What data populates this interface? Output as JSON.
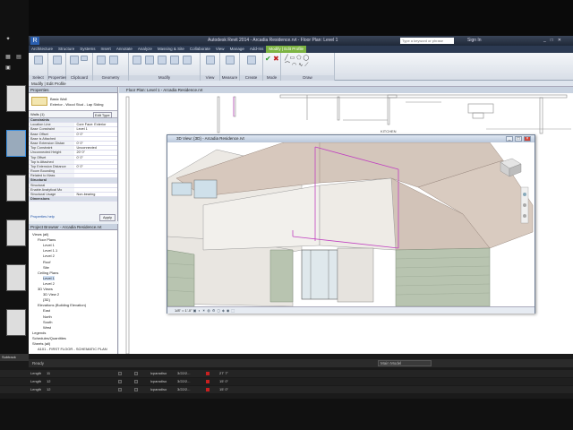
{
  "titlebar": {
    "title": "Autodesk Revit 2014 - Arcadia Residence.rvt - Floor Plan: Level 1",
    "search_placeholder": "Type a keyword or phrase",
    "sign_in": "Sign In"
  },
  "ribbon": {
    "tabs": [
      "Architecture",
      "Structure",
      "Systems",
      "Insert",
      "Annotate",
      "Analyze",
      "Massing & Site",
      "Collaborate",
      "View",
      "Manage",
      "Add-Ins",
      "Modify | Edit Profile"
    ],
    "active_tab": "Modify | Edit Profile",
    "groups": [
      "Select",
      "Properties",
      "Clipboard",
      "Geometry",
      "Modify",
      "View",
      "Measure",
      "Create",
      "Mode",
      "Draw"
    ]
  },
  "statusline": "Modify | Edit Profile",
  "properties": {
    "header": "Properties",
    "family": "Basic Wall",
    "type": "Exterior - Wood Stud - Lap Siding",
    "selector": "Walls (1)",
    "edit_type": "Edit Type",
    "rows": [
      {
        "k": "Constraints",
        "v": "",
        "sec": true
      },
      {
        "k": "Location Line",
        "v": "Core Face: Exterior"
      },
      {
        "k": "Base Constraint",
        "v": "Level 1"
      },
      {
        "k": "Base Offset",
        "v": "0' 0\""
      },
      {
        "k": "Base is Attached",
        "v": ""
      },
      {
        "k": "Base Extension Distan",
        "v": "0' 0\""
      },
      {
        "k": "Top Constraint",
        "v": "Unconnected"
      },
      {
        "k": "Unconnected Height",
        "v": "20' 0\""
      },
      {
        "k": "Top Offset",
        "v": "0' 0\""
      },
      {
        "k": "Top is Attached",
        "v": ""
      },
      {
        "k": "Top Extension Distance",
        "v": "0' 0\""
      },
      {
        "k": "Room Bounding",
        "v": ""
      },
      {
        "k": "Related to Mass",
        "v": ""
      },
      {
        "k": "Structural",
        "v": "",
        "sec": true
      },
      {
        "k": "Structural",
        "v": ""
      },
      {
        "k": "Enable Analytical Mo",
        "v": ""
      },
      {
        "k": "Structural Usage",
        "v": "Non-bearing"
      },
      {
        "k": "Dimensions",
        "v": "",
        "sec": true
      }
    ],
    "help_link": "Properties help",
    "apply": "Apply"
  },
  "browser": {
    "header": "Project Browser - Arcadia Residence.rvt",
    "items": [
      "Views (all)",
      "Floor Plans",
      "Level 1",
      "Level 1.1",
      "Level 2",
      "Roof",
      "Site",
      "Ceiling Plans",
      "Level 1",
      "Level 2",
      "3D Views",
      "3D View 2",
      "{3D}",
      "Elevations (Building Elevation)",
      "East",
      "North",
      "South",
      "West",
      "Legends",
      "Schedules/Quantities",
      "Sheets (all)",
      "A101 - FIRST FLOOR - SCHEMATIC PLAN"
    ]
  },
  "floorplan_tab": "Floor Plan: Level 1 - Arcadia Residence.rvt",
  "floorplan_label": "KITCHEN",
  "view3d": {
    "title": "3D View: {3D} - Arcadia Residence.rvt",
    "scale": "1/8\" = 1'-0\""
  },
  "app_status": {
    "text": "Ready",
    "model": "Main Model"
  },
  "timeline": {
    "rows": [
      {
        "track": "12",
        "name": "Length",
        "num": "11",
        "user": "lcparadiso",
        "date": "3/22/2...",
        "val": "27' 7\""
      },
      {
        "track": "",
        "name": "Length",
        "num": "12",
        "user": "lcparadiso",
        "date": "3/22/2...",
        "val": "15' 0\""
      },
      {
        "track": "",
        "name": "Length",
        "num": "12",
        "user": "lcparadiso",
        "date": "3/22/2...",
        "val": "15' 0\""
      }
    ],
    "subtrack_label": "Subtrack",
    "group_label": "12 (2)"
  },
  "colors": {
    "ribbon_active": "#7cb342",
    "roof": "#d7c8bd",
    "siding": "#b8c4b0",
    "sketch_magenta": "#c040c0"
  }
}
